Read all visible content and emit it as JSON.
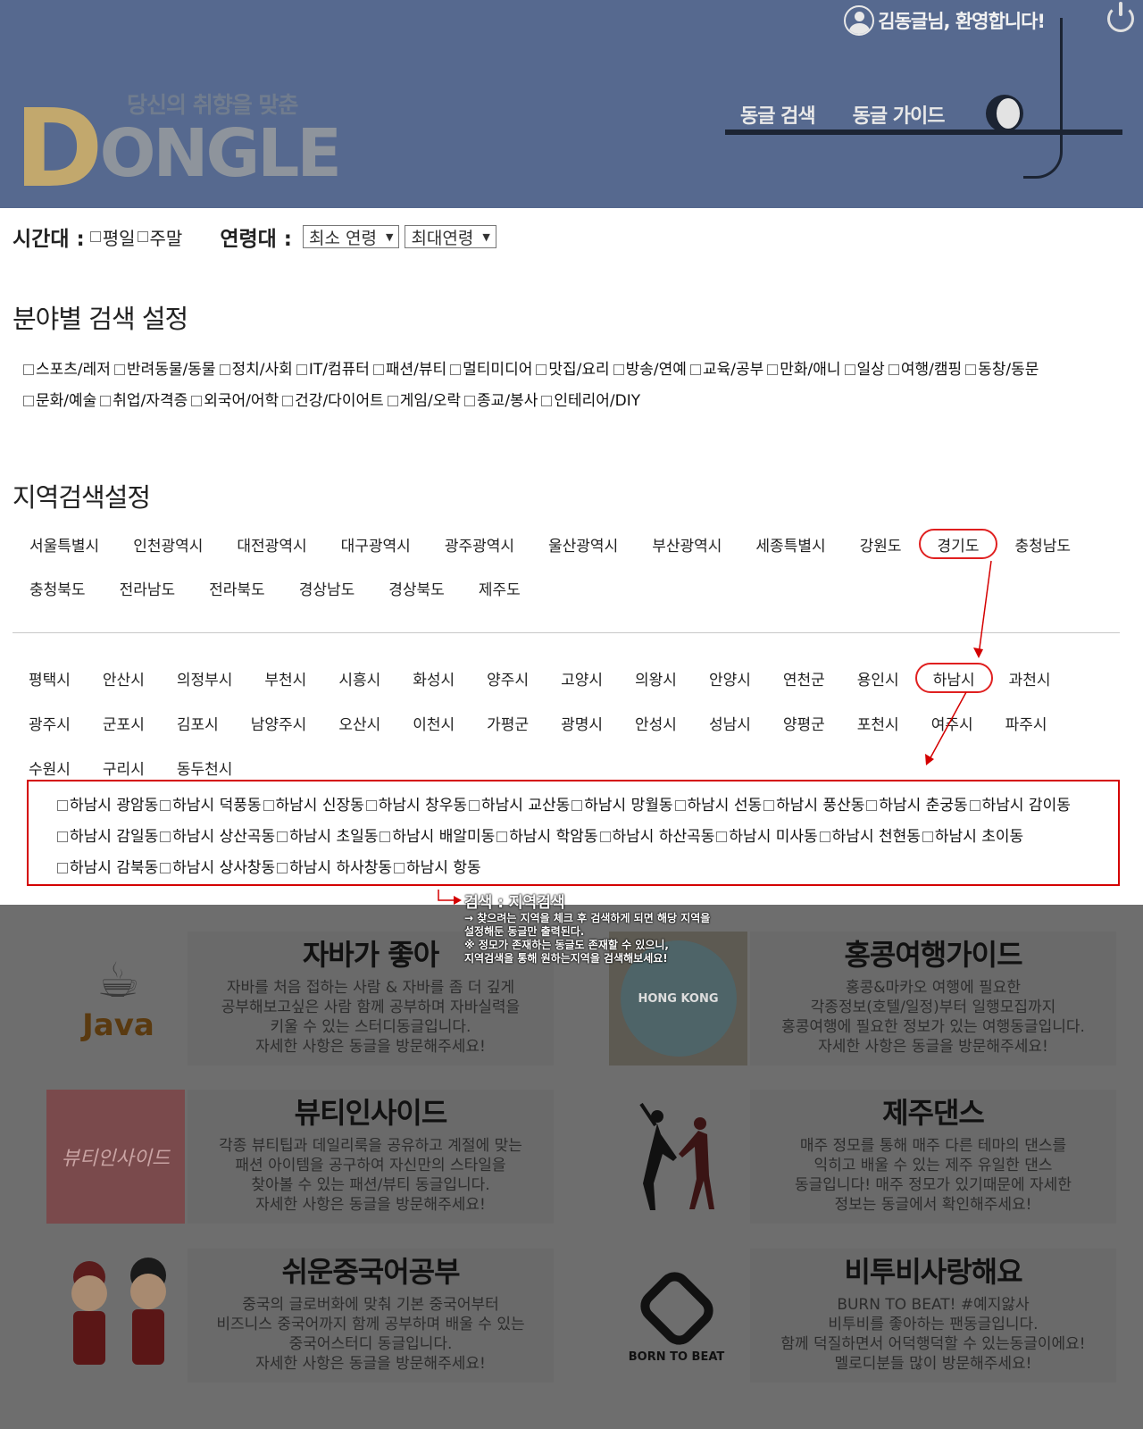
{
  "header": {
    "welcome": "김동글님, 환영합니다!",
    "slogan": "당신의 취향을 맞춘",
    "logo_first": "D",
    "logo_rest": "ONGLE",
    "nav": [
      "동글 검색",
      "동글 가이드"
    ]
  },
  "filters": {
    "time_label": "시간대 :",
    "time_options": [
      "평일",
      "주말"
    ],
    "age_label": "연령대 :",
    "min_age": "최소 연령",
    "max_age": "최대연령"
  },
  "category_section": {
    "title": "분야별 검색 설정",
    "items": [
      "스포츠/레저",
      "반려동물/동물",
      "정치/사회",
      "IT/컴퓨터",
      "패션/뷰티",
      "멀티미디어",
      "맛집/요리",
      "방송/연예",
      "교육/공부",
      "만화/애니",
      "일상",
      "여행/캠핑",
      "동창/동문",
      "문화/예술",
      "취업/자격증",
      "외국어/어학",
      "건강/다이어트",
      "게임/오락",
      "종교/봉사",
      "인테리어/DIY"
    ]
  },
  "region_section": {
    "title": "지역검색설정",
    "provinces_row1": [
      "서울특별시",
      "인천광역시",
      "대전광역시",
      "대구광역시",
      "광주광역시",
      "울산광역시",
      "부산광역시",
      "세종특별시",
      "강원도",
      "경기도",
      "충청남도"
    ],
    "provinces_row2": [
      "충청북도",
      "전라남도",
      "전라북도",
      "경상남도",
      "경상북도",
      "제주도"
    ],
    "selected_province": "경기도",
    "cities_row1": [
      "평택시",
      "안산시",
      "의정부시",
      "부천시",
      "시흥시",
      "화성시",
      "양주시",
      "고양시",
      "의왕시",
      "안양시",
      "연천군",
      "용인시",
      "하남시",
      "과천시"
    ],
    "cities_row2": [
      "광주시",
      "군포시",
      "김포시",
      "남양주시",
      "오산시",
      "이천시",
      "가평군",
      "광명시",
      "안성시",
      "성남시",
      "양평군",
      "포천시",
      "여주시",
      "파주시"
    ],
    "cities_row3": [
      "수원시",
      "구리시",
      "동두천시"
    ],
    "selected_city": "하남시",
    "dongs": [
      "하남시 광암동",
      "하남시 덕풍동",
      "하남시 신장동",
      "하남시 창우동",
      "하남시 교산동",
      "하남시 망월동",
      "하남시 선동",
      "하남시 풍산동",
      "하남시 춘궁동",
      "하남시 감이동",
      "하남시 감일동",
      "하남시 상산곡동",
      "하남시 초일동",
      "하남시 배알미동",
      "하남시 학암동",
      "하남시 하산곡동",
      "하남시 미사동",
      "하남시 천현동",
      "하남시 초이동",
      "하남시 감북동",
      "하남시 상사창동",
      "하남시 하사창동",
      "하남시 항동"
    ]
  },
  "annotation": {
    "title": "검색 : 지역검색",
    "lines": [
      "→ 찾으려는 지역을 체크 후 검색하게 되면 해당 지역을",
      "설정해둔 동글만 출력된다.",
      "※ 정모가 존재하는 동글도 존재할 수 있으니,",
      "지역검색을 통해 원하는지역을 검색해보세요!"
    ]
  },
  "cards": [
    {
      "title": "자바가 좋아",
      "img_label": "Java",
      "desc": [
        "자바를 처음 접하는 사람 & 자바를 좀 더 깊게",
        "공부해보고싶은 사람 함께 공부하며 자바실력을",
        "키울 수 있는 스터디동글입니다.",
        "자세한 사항은 동글을 방문해주세요!"
      ]
    },
    {
      "title": "홍콩여행가이드",
      "img_label": "HONG KONG",
      "desc": [
        "홍콩&마카오 여행에 필요한",
        "각종정보(호텔/일정)부터 일행모집까지",
        "홍콩여행에 필요한 정보가 있는 여행동글입니다.",
        "자세한 사항은 동글을 방문해주세요!"
      ]
    },
    {
      "title": "뷰티인사이드",
      "img_label": "뷰티인사이드",
      "desc": [
        "각종 뷰티팁과 데일리룩을 공유하고 계절에 맞는",
        "패션 아이템을 공구하여 자신만의 스타일을",
        "찾아볼 수 있는 패션/뷰티 동글입니다.",
        "자세한 사항은 동글을 방문해주세요!"
      ]
    },
    {
      "title": "제주댄스",
      "img_label": "",
      "desc": [
        "매주 정모를 통해 매주 다른 테마의 댄스를",
        "익히고 배울 수 있는 제주 유일한 댄스",
        "동글입니다! 매주 정모가 있기때문에 자세한",
        "정보는 동글에서 확인해주세요!"
      ]
    },
    {
      "title": "쉬운중국어공부",
      "img_label": "",
      "desc": [
        "중국의 글로버화에 맞춰 기본 중국어부터",
        "비즈니스 중국어까지 함께 공부하며 배울 수 있는",
        "중국어스터디 동글입니다.",
        "자세한 사항은 동글을 방문해주세요!"
      ]
    },
    {
      "title": "비투비사랑해요",
      "img_label": "BORN TO BEAT",
      "desc": [
        "BURN TO BEAT! #예지앓사",
        "비투비를 좋아하는 팬동글입니다.",
        "함께 덕질하면서 어덕행덕할 수 있는동글이에요!",
        "멜로디분들 많이 방문해주세요!"
      ]
    }
  ],
  "colors": {
    "header_bg": "#56698f",
    "highlight": "#d40000",
    "logo_gold": "#c2a86d"
  }
}
